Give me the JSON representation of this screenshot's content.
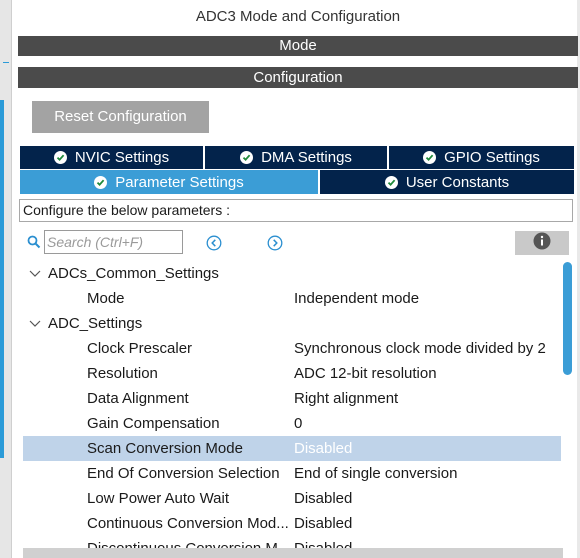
{
  "panel": {
    "title": "ADC3 Mode and Configuration",
    "mode_header": "Mode",
    "config_header": "Configuration"
  },
  "reset_button": "Reset Configuration",
  "tabs": [
    {
      "label": "NVIC Settings",
      "active": false,
      "icon": "check-circle-icon"
    },
    {
      "label": "DMA Settings",
      "active": false,
      "icon": "check-circle-icon"
    },
    {
      "label": "GPIO Settings",
      "active": false,
      "icon": "check-circle-icon"
    },
    {
      "label": "Parameter Settings",
      "active": true,
      "icon": "check-circle-icon"
    },
    {
      "label": "User Constants",
      "active": false,
      "icon": "check-circle-icon"
    }
  ],
  "configure_label": "Configure the below parameters :",
  "search": {
    "placeholder": "Search (Ctrl+F)",
    "value": ""
  },
  "tree": {
    "groups": [
      {
        "name": "ADCs_Common_Settings",
        "expanded": true,
        "params": [
          {
            "name": "Mode",
            "value": "Independent mode"
          }
        ]
      },
      {
        "name": "ADC_Settings",
        "expanded": true,
        "params": [
          {
            "name": "Clock Prescaler",
            "value": "Synchronous clock mode divided by 2"
          },
          {
            "name": "Resolution",
            "value": "ADC 12-bit resolution"
          },
          {
            "name": "Data Alignment",
            "value": "Right alignment"
          },
          {
            "name": "Gain Compensation",
            "value": "0"
          },
          {
            "name": "Scan Conversion Mode",
            "value": "Disabled",
            "selected": true
          },
          {
            "name": "End Of Conversion Selection",
            "value": "End of single conversion"
          },
          {
            "name": "Low Power Auto Wait",
            "value": "Disabled"
          },
          {
            "name": "Continuous Conversion Mod...",
            "value": "Disabled"
          },
          {
            "name": "Discontinuous Conversion M...",
            "value": "Disabled"
          }
        ]
      }
    ]
  },
  "colors": {
    "tab_bg": "#03234b",
    "tab_active": "#3b9dd6",
    "header_bar": "#4b4b4b",
    "selected_row": "#bfd3e9",
    "button_gray": "#a3a3a3"
  }
}
